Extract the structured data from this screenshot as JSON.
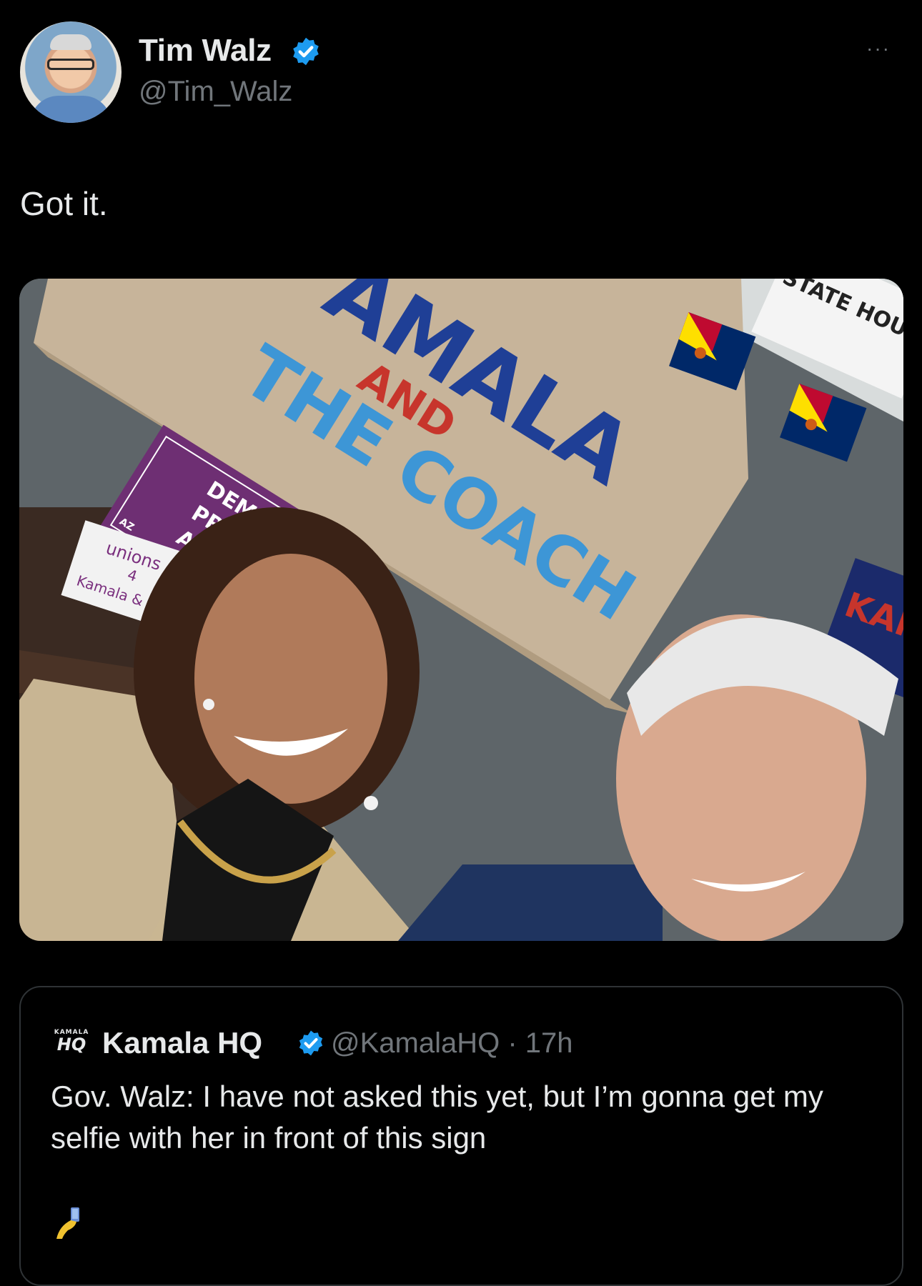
{
  "post": {
    "author": {
      "name": "Tim Walz",
      "handle": "@Tim_Walz",
      "verified": true,
      "avatar_icon": "profile-photo"
    },
    "more_icon": "ellipsis-icon",
    "more_label": "···",
    "text": "Got it.",
    "media": {
      "banner_line1": "AMALA",
      "banner_line2": "AND",
      "banner_line3": "THE",
      "banner_line4": "COACH",
      "purple_sign_line1": "DEMOCRATS",
      "purple_sign_line2": "PROTECT",
      "purple_sign_line3": "ABORTIO",
      "purple_sign_tag": "AZ",
      "handwritten_line1": "unions",
      "handwritten_line2": "4",
      "handwritten_line3": "Kamala & Walz",
      "state_house_sign": "STATE HOU",
      "kam_sign": "KAM"
    }
  },
  "quote": {
    "avatar_small": "KAMALA",
    "avatar_big": "HQ",
    "name": "Kamala HQ",
    "handle_time": "@KamalaHQ · 17h",
    "verified": true,
    "text": "Gov. Walz: I have not asked this yet, but I’m gonna get my selfie with her in front of this sign",
    "emoji_icon": "selfie-emoji"
  },
  "colors": {
    "background": "#000000",
    "text_primary": "#e7e9ea",
    "text_secondary": "#71767b",
    "verified_blue": "#1d9bf0",
    "border": "#2f3336"
  }
}
